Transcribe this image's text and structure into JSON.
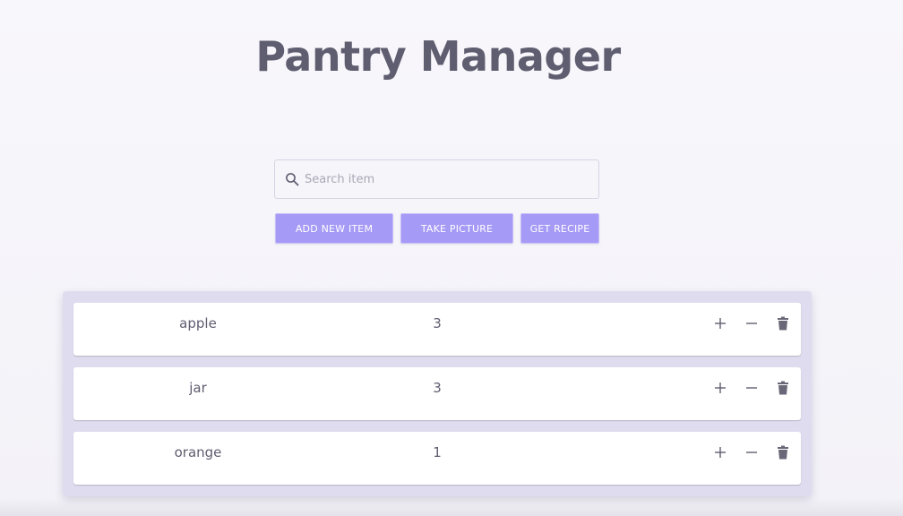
{
  "page": {
    "title": "Pantry Manager"
  },
  "search": {
    "placeholder": "Search item",
    "value": "",
    "icon": "search-icon"
  },
  "actions": {
    "add_label": "ADD NEW ITEM",
    "picture_label": "TAKE PICTURE",
    "recipe_label": "GET RECIPE"
  },
  "items": [
    {
      "name": "apple",
      "quantity": "3"
    },
    {
      "name": "jar",
      "quantity": "3"
    },
    {
      "name": "orange",
      "quantity": "1"
    }
  ],
  "icons": {
    "increment": "plus-icon",
    "decrement": "minus-icon",
    "delete": "trash-icon"
  },
  "colors": {
    "accent": "#a59af5",
    "title": "#5f5d70",
    "list_background": "#dedcee",
    "page_background": "#f5f4f9"
  }
}
